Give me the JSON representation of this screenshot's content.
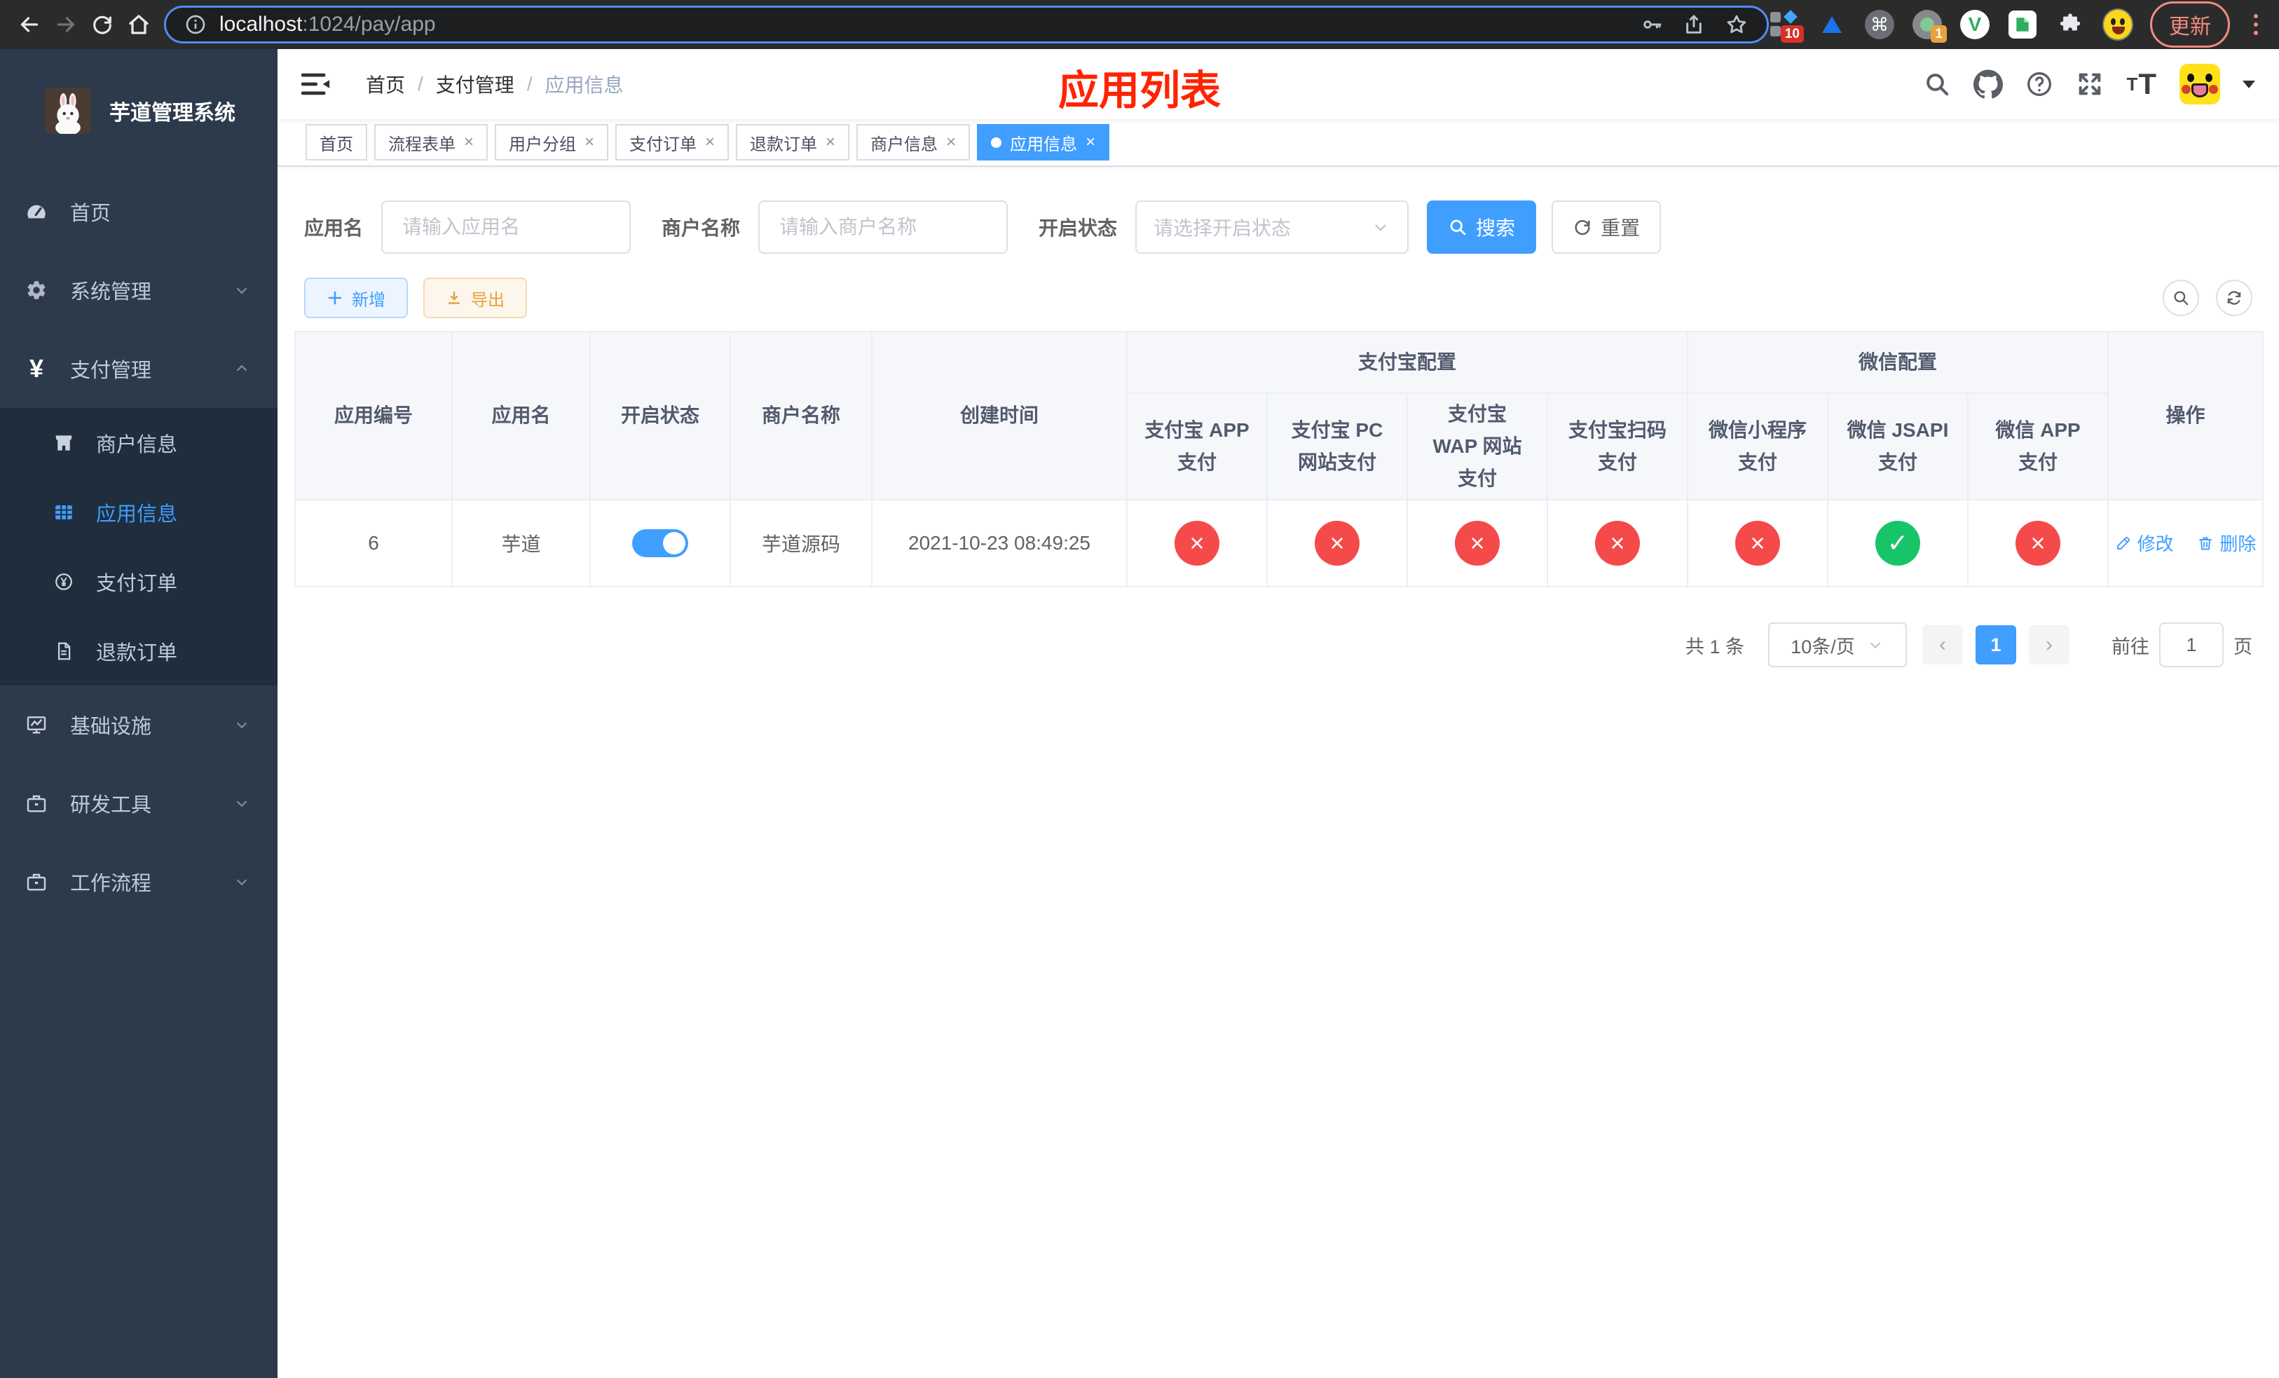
{
  "browser": {
    "url_host": "localhost",
    "url_rest": ":1024/pay/app",
    "update_label": "更新",
    "ext_badge_blue": "10",
    "ext_badge_orange": "1",
    "ext_v_letter": "V",
    "ext_command_glyph": "⌘"
  },
  "sidebar": {
    "title": "芋道管理系统",
    "items": [
      {
        "label": "首页"
      },
      {
        "label": "系统管理"
      },
      {
        "label": "支付管理"
      },
      {
        "label": "基础设施"
      },
      {
        "label": "研发工具"
      },
      {
        "label": "工作流程"
      }
    ],
    "sub_items": [
      {
        "label": "商户信息"
      },
      {
        "label": "应用信息"
      },
      {
        "label": "支付订单"
      },
      {
        "label": "退款订单"
      }
    ]
  },
  "header": {
    "breadcrumb": [
      "首页",
      "支付管理",
      "应用信息"
    ],
    "separator": "/",
    "page_title": "应用列表",
    "font_small_t": "T",
    "font_big_t": "T"
  },
  "tabs": [
    {
      "label": "首页",
      "closable": false,
      "active": false
    },
    {
      "label": "流程表单",
      "closable": true,
      "active": false
    },
    {
      "label": "用户分组",
      "closable": true,
      "active": false
    },
    {
      "label": "支付订单",
      "closable": true,
      "active": false
    },
    {
      "label": "退款订单",
      "closable": true,
      "active": false
    },
    {
      "label": "商户信息",
      "closable": true,
      "active": false
    },
    {
      "label": "应用信息",
      "closable": true,
      "active": true
    }
  ],
  "filters": {
    "app_name_label": "应用名",
    "app_name_placeholder": "请输入应用名",
    "merchant_label": "商户名称",
    "merchant_placeholder": "请输入商户名称",
    "status_label": "开启状态",
    "status_placeholder": "请选择开启状态",
    "search_label": "搜索",
    "reset_label": "重置"
  },
  "toolbar": {
    "add_label": "新增",
    "export_label": "导出"
  },
  "table": {
    "headers": {
      "app_id": "应用编号",
      "app_name": "应用名",
      "status": "开启状态",
      "merchant": "商户名称",
      "created": "创建时间",
      "alipay_group": "支付宝配置",
      "wechat_group": "微信配置",
      "channels": [
        "支付宝 APP 支付",
        "支付宝 PC 网站支付",
        "支付宝 WAP 网站支付",
        "支付宝扫码支付",
        "微信小程序支付",
        "微信 JSAPI 支付",
        "微信 APP 支付"
      ],
      "actions": "操作"
    },
    "row": {
      "app_id": "6",
      "app_name": "芋道",
      "enabled": true,
      "merchant": "芋道源码",
      "created": "2021-10-23 08:49:25",
      "channels": [
        false,
        false,
        false,
        false,
        false,
        true,
        false
      ],
      "edit_label": "修改",
      "delete_label": "删除"
    }
  },
  "pagination": {
    "total": "共 1 条",
    "page_size": "10条/页",
    "current_page": "1",
    "goto_label": "前往",
    "goto_value": "1",
    "unit_label": "页"
  },
  "colors": {
    "primary": "#409eff",
    "danger": "#f54a4a",
    "success": "#17c568",
    "title_red": "#ff2300",
    "sidebar_bg": "#2d3a4b",
    "sidebar_sub_bg": "#1f2d3d"
  }
}
